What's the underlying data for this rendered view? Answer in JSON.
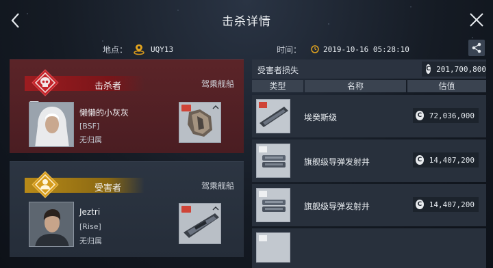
{
  "header": {
    "title": "击杀详情"
  },
  "location": {
    "label": "地点：",
    "value": "UQY13"
  },
  "time": {
    "label": "时间：",
    "value": "2019-10-16 05:28:10"
  },
  "killer": {
    "role_label": "击杀者",
    "ship_caption": "驾乘舰船",
    "pilot_name": "懒懒的小灰灰",
    "corp": "[BSF]",
    "alliance": "无归属",
    "accent_color": "#9c1c20"
  },
  "victim": {
    "role_label": "受害者",
    "ship_caption": "驾乘舰船",
    "pilot_name": "Jeztri",
    "corp": "[Rise]",
    "alliance": "无归属",
    "accent_color": "#b88a18"
  },
  "losses": {
    "title": "受害者损失",
    "total": "201,700,800",
    "columns": [
      "类型",
      "名称",
      "估值"
    ],
    "currency_icon": "C",
    "items": [
      {
        "name": "埃癸斯级",
        "value": "72,036,000"
      },
      {
        "name": "旗舰级导弹发射井",
        "value": "14,407,200"
      },
      {
        "name": "旗舰级导弹发射井",
        "value": "14,407,200"
      }
    ]
  },
  "icons": {
    "back": "chevron-left-icon",
    "close": "close-icon",
    "share": "share-icon",
    "pin": "location-pin-icon",
    "clock": "clock-icon"
  }
}
